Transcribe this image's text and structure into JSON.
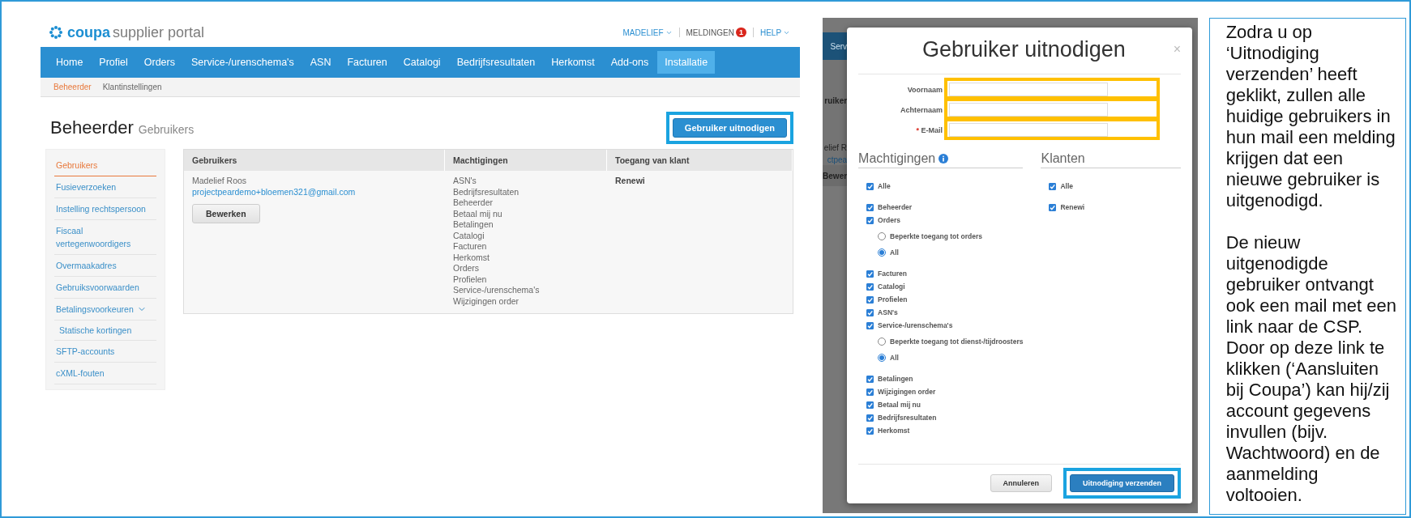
{
  "portal": {
    "logo_brand": "coupa",
    "logo_product": "supplier portal",
    "user_menu": "MADELIEF",
    "notifications": {
      "label": "MELDINGEN",
      "count": "1"
    },
    "help": "HELP",
    "nav": [
      {
        "label": "Home",
        "selected": false
      },
      {
        "label": "Profiel",
        "selected": false
      },
      {
        "label": "Orders",
        "selected": false
      },
      {
        "label": "Service-/urenschema's",
        "selected": false
      },
      {
        "label": "ASN",
        "selected": false
      },
      {
        "label": "Facturen",
        "selected": false
      },
      {
        "label": "Catalogi",
        "selected": false
      },
      {
        "label": "Bedrijfsresultaten",
        "selected": false
      },
      {
        "label": "Herkomst",
        "selected": false
      },
      {
        "label": "Add-ons",
        "selected": false
      },
      {
        "label": "Installatie",
        "selected": true
      }
    ],
    "subnav": [
      {
        "label": "Beheerder",
        "selected": true
      },
      {
        "label": "Klantinstellingen",
        "selected": false
      }
    ],
    "page_title": "Beheerder",
    "page_subtitle": "Gebruikers",
    "invite_button": {
      "label": "Gebruiker uitnodigen",
      "highlighted": true
    },
    "sidebar": [
      {
        "label": "Gebruikers",
        "selected": true
      },
      {
        "label": "Fusieverzoeken",
        "selected": false
      },
      {
        "label": "Instelling rechtspersoon",
        "selected": false
      },
      {
        "label": "Fiscaal vertegenwoordigers",
        "selected": false
      },
      {
        "label": "Overmaakadres",
        "selected": false
      },
      {
        "label": "Gebruiksvoorwaarden",
        "selected": false
      },
      {
        "label": "Betalingsvoorkeuren",
        "selected": false,
        "expanded": true,
        "children": [
          {
            "label": "Statische kortingen",
            "selected": false
          }
        ]
      },
      {
        "label": "SFTP-accounts",
        "selected": false
      },
      {
        "label": "cXML-fouten",
        "selected": false
      }
    ],
    "table": {
      "columns": [
        "Gebruikers",
        "Machtigingen",
        "Toegang van klant"
      ],
      "rows": [
        {
          "name": "Madelief Roos",
          "email": "projectpeardemo+bloemen321@gmail.com",
          "button": "Bewerken",
          "permissions": [
            "ASN's",
            "Bedrijfsresultaten",
            "Beheerder",
            "Betaal mij nu",
            "Betalingen",
            "Catalogi",
            "Facturen",
            "Herkomst",
            "Orders",
            "Profielen",
            "Service-/urenschema's",
            "Wijzigingen order"
          ],
          "customers": "Renewi"
        }
      ]
    }
  },
  "modal_screenshot": {
    "backdrop_fragments": [
      "Serv",
      "ruiker",
      "elief R",
      "ctpea",
      "Bewer"
    ],
    "title": "Gebruiker uitnodigen",
    "close": "×",
    "fields": [
      {
        "label": "Voornaam",
        "highlighted": true
      },
      {
        "label": "Achternaam",
        "highlighted": true
      },
      {
        "label": "E-Mail",
        "required_mark": "*",
        "highlighted": true
      }
    ],
    "permissions_heading": "Machtigingen",
    "customers_heading": "Klanten",
    "permissions": [
      {
        "kind": "checkbox",
        "label": "Alle",
        "checked": true
      },
      {
        "kind": "checkbox",
        "label": "Beheerder",
        "checked": true
      },
      {
        "kind": "checkbox",
        "label": "Orders",
        "checked": true
      },
      {
        "kind": "radio",
        "label": "Beperkte toegang tot orders",
        "selected": false
      },
      {
        "kind": "radio",
        "label": "All",
        "selected": true
      },
      {
        "kind": "checkbox",
        "label": "Facturen",
        "checked": true
      },
      {
        "kind": "checkbox",
        "label": "Catalogi",
        "checked": true
      },
      {
        "kind": "checkbox",
        "label": "Profielen",
        "checked": true
      },
      {
        "kind": "checkbox",
        "label": "ASN's",
        "checked": true
      },
      {
        "kind": "checkbox",
        "label": "Service-/urenschema's",
        "checked": true
      },
      {
        "kind": "radio",
        "label": "Beperkte toegang tot dienst-/tijdroosters",
        "selected": false
      },
      {
        "kind": "radio",
        "label": "All",
        "selected": true
      },
      {
        "kind": "checkbox",
        "label": "Betalingen",
        "checked": true
      },
      {
        "kind": "checkbox",
        "label": "Wijzigingen order",
        "checked": true
      },
      {
        "kind": "checkbox",
        "label": "Betaal mij nu",
        "checked": true
      },
      {
        "kind": "checkbox",
        "label": "Bedrijfsresultaten",
        "checked": true
      },
      {
        "kind": "checkbox",
        "label": "Herkomst",
        "checked": true
      }
    ],
    "customers": [
      {
        "label": "Alle",
        "checked": true
      },
      {
        "label": "Renewi",
        "checked": true
      }
    ],
    "buttons": [
      {
        "kind": "secondary",
        "label": "Annuleren",
        "highlighted": false
      },
      {
        "kind": "primary",
        "label": "Uitnodiging verzenden",
        "highlighted": true
      }
    ]
  },
  "note": {
    "paragraphs": [
      "Zodra u op ‘Uitnodiging verzenden’ heeft geklikt, zullen alle huidige gebruikers in hun mail een melding krijgen dat een nieuwe gebruiker is uitgenodigd.",
      "De nieuw uitgenodigde gebruiker ontvangt ook een mail met een link naar de CSP. Door op deze link te klikken (‘Aansluiten bij Coupa’) kan hij/zij account gegevens invullen (bijv. Wachtwoord) en de aanmelding voltooien."
    ]
  }
}
